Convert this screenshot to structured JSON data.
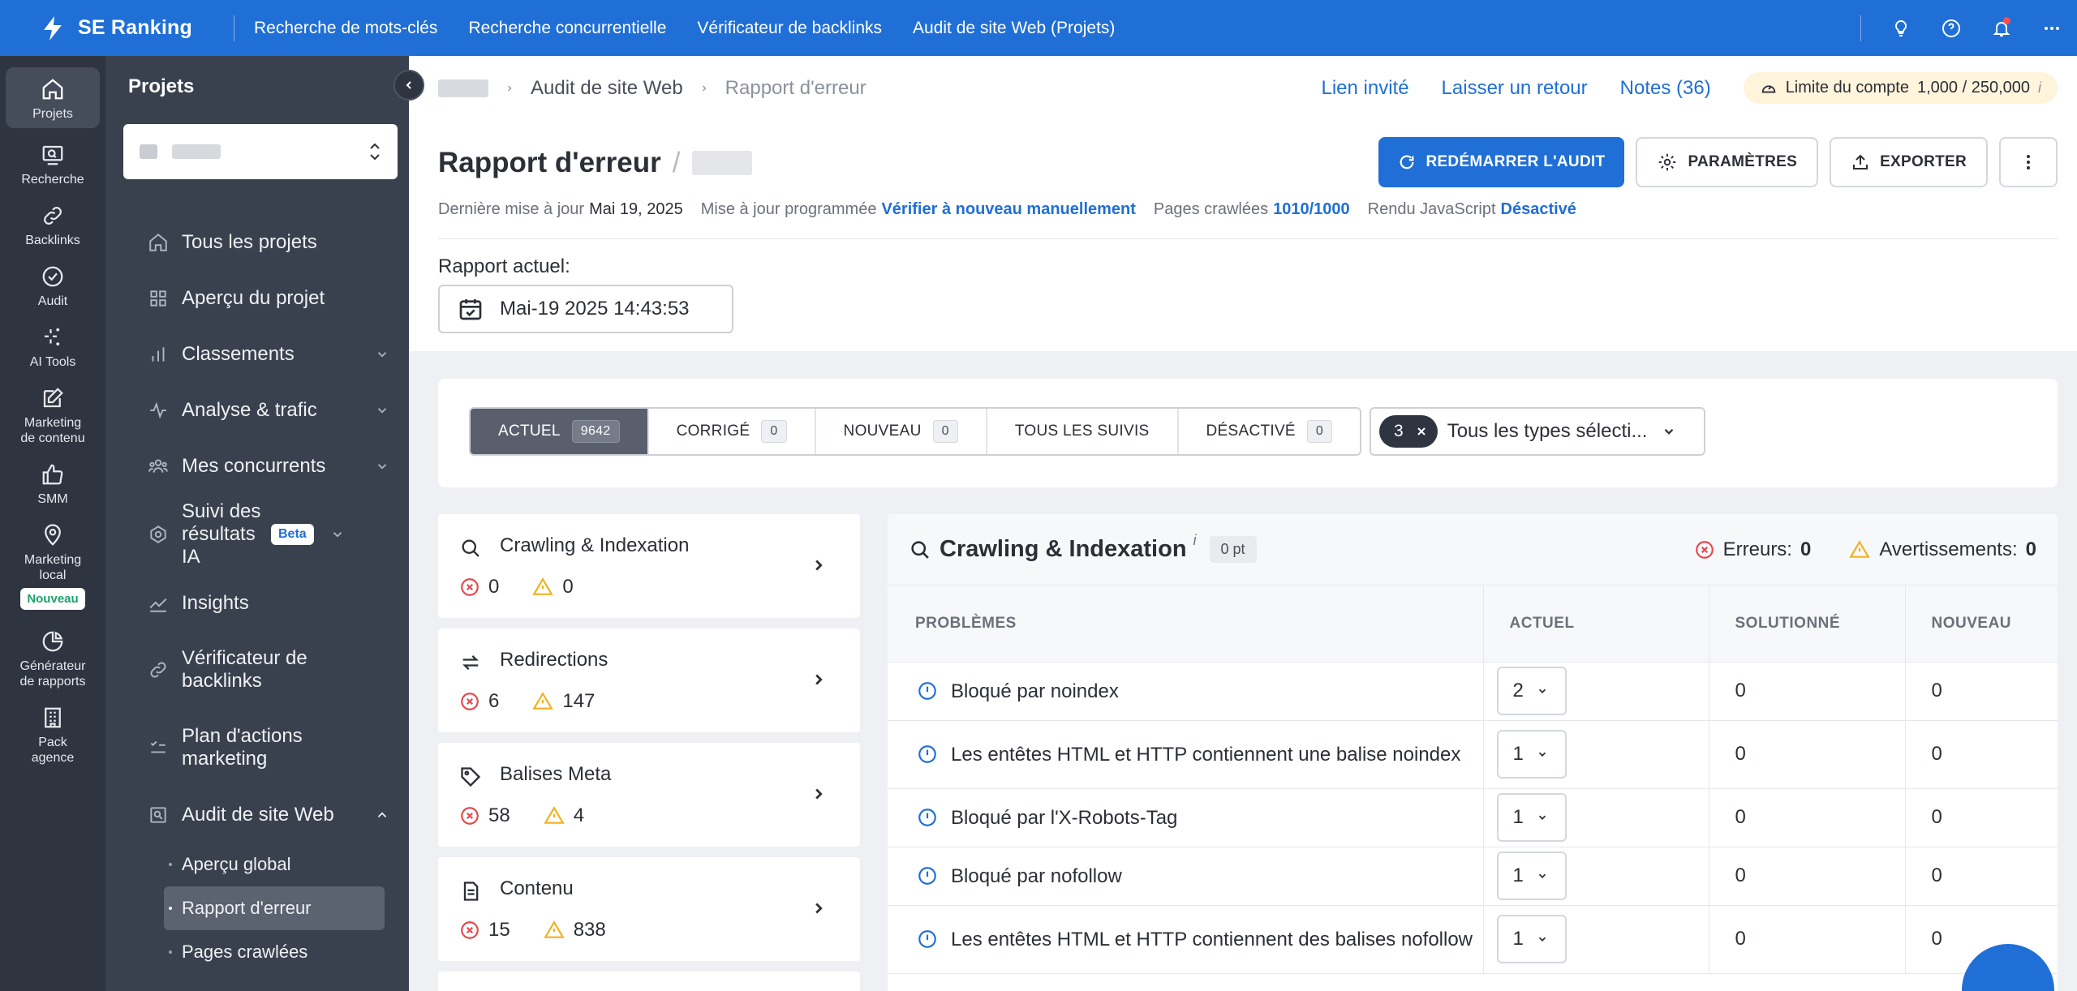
{
  "app": {
    "brand": "SE Ranking",
    "top_nav": [
      "Recherche de mots-clés",
      "Recherche concurrentielle",
      "Vérificateur de backlinks",
      "Audit de site Web (Projets)"
    ]
  },
  "rail": {
    "items": [
      {
        "label": "Projets",
        "icon": "home-icon"
      },
      {
        "label": "Recherche",
        "icon": "search-screen-icon"
      },
      {
        "label": "Backlinks",
        "icon": "link-icon"
      },
      {
        "label": "Audit",
        "icon": "check-circle-icon"
      },
      {
        "label": "AI Tools",
        "icon": "sparkle-icon"
      },
      {
        "label": "Marketing de contenu",
        "icon": "edit-icon"
      },
      {
        "label": "SMM",
        "icon": "thumbs-up-icon"
      },
      {
        "label": "Marketing local",
        "icon": "location-pin-icon"
      },
      {
        "label": "Générateur de rapports",
        "icon": "pie-chart-icon"
      },
      {
        "label": "Pack agence",
        "icon": "building-icon"
      }
    ],
    "new_badge": "Nouveau"
  },
  "panel": {
    "title": "Projets",
    "items": [
      {
        "label": "Tous les projets",
        "icon": "home-outline-icon"
      },
      {
        "label": "Aperçu du projet",
        "icon": "grid-icon"
      },
      {
        "label": "Classements",
        "icon": "bar-chart-icon"
      },
      {
        "label": "Analyse & trafic",
        "icon": "pulse-icon"
      },
      {
        "label": "Mes concurrents",
        "icon": "users-icon"
      },
      {
        "label": "Suivi des résultats IA",
        "icon": "ai-radar-icon",
        "badge": "Beta"
      },
      {
        "label": "Insights",
        "icon": "trend-icon"
      },
      {
        "label": "Vérificateur de backlinks",
        "icon": "link-outline-icon"
      },
      {
        "label": "Plan d'actions marketing",
        "icon": "checklist-icon"
      },
      {
        "label": "Audit de site Web",
        "icon": "audit-icon"
      }
    ],
    "sub_items": [
      "Aperçu global",
      "Rapport d'erreur",
      "Pages crawlées"
    ]
  },
  "header": {
    "breadcrumb": [
      "Audit de site Web",
      "Rapport d'erreur"
    ],
    "links": [
      "Lien invité",
      "Laisser un retour",
      "Notes (36)"
    ],
    "limit_label": "Limite du compte",
    "limit_value": "1,000 / 250,000",
    "limit_info": "i",
    "title": "Rapport d'erreur",
    "title_slash": "/",
    "buttons": {
      "restart": "REDÉMARRER L'AUDIT",
      "settings": "PARAMÈTRES",
      "export": "EXPORTER"
    },
    "meta": {
      "last_update_label": "Dernière mise à jour",
      "last_update_value": "Mai 19, 2025",
      "scheduled_label": "Mise à jour programmée",
      "scheduled_value": "Vérifier à nouveau manuellement",
      "pages_label": "Pages crawlées",
      "pages_value": "1010/1000",
      "js_label": "Rendu JavaScript",
      "js_value": "Désactivé"
    },
    "report_label": "Rapport actuel:",
    "report_date": "Mai-19 2025 14:43:53"
  },
  "filters": {
    "segments": [
      {
        "label": "ACTUEL",
        "count": "9642"
      },
      {
        "label": "CORRIGÉ",
        "count": "0"
      },
      {
        "label": "NOUVEAU",
        "count": "0"
      },
      {
        "label": "TOUS LES SUIVIS",
        "count": ""
      },
      {
        "label": "DÉSACTIVÉ",
        "count": "0"
      }
    ],
    "types_count": "3",
    "types_label": "Tous les types sélecti..."
  },
  "categories": [
    {
      "title": "Crawling & Indexation",
      "errors": "0",
      "warnings": "0",
      "icon": "search-icon"
    },
    {
      "title": "Redirections",
      "errors": "6",
      "warnings": "147",
      "icon": "redirect-icon"
    },
    {
      "title": "Balises Meta",
      "errors": "58",
      "warnings": "4",
      "icon": "tag-icon"
    },
    {
      "title": "Contenu",
      "errors": "15",
      "warnings": "838",
      "icon": "document-icon"
    }
  ],
  "detail": {
    "title": "Crawling & Indexation",
    "info": "i",
    "points": "0 pt",
    "errors_label": "Erreurs:",
    "errors_value": "0",
    "warnings_label": "Avertissements:",
    "warnings_value": "0",
    "columns": [
      "PROBLÈMES",
      "ACTUEL",
      "SOLUTIONNÉ",
      "NOUVEAU"
    ],
    "rows": [
      {
        "problem": "Bloqué par noindex",
        "actuel": "2",
        "solved": "0",
        "new": "0"
      },
      {
        "problem": "Les entêtes HTML et HTTP contiennent une balise noindex",
        "actuel": "1",
        "solved": "0",
        "new": "0"
      },
      {
        "problem": "Bloqué par l'X-Robots-Tag",
        "actuel": "1",
        "solved": "0",
        "new": "0"
      },
      {
        "problem": "Bloqué par nofollow",
        "actuel": "1",
        "solved": "0",
        "new": "0"
      },
      {
        "problem": "Les entêtes HTML et HTTP contiennent des balises nofollow",
        "actuel": "1",
        "solved": "0",
        "new": "0"
      }
    ]
  },
  "colors": {
    "brand": "#1f6fd6",
    "rail": "#2e3440",
    "panel": "#3a414e",
    "error": "#e5484d",
    "warning": "#f2b01e"
  }
}
